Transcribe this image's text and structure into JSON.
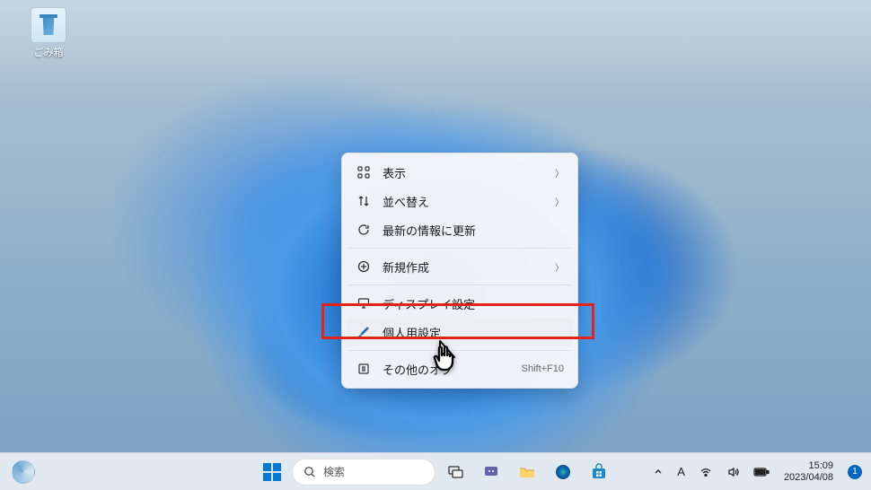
{
  "desktop": {
    "recycle_bin_label": "ごみ箱"
  },
  "context_menu": {
    "view": "表示",
    "sort": "並べ替え",
    "refresh": "最新の情報に更新",
    "new": "新規作成",
    "display_settings": "ディスプレイ設定",
    "personalize": "個人用設定",
    "more_options": "その他のオプ",
    "more_options_shortcut": "Shift+F10"
  },
  "taskbar": {
    "search_placeholder": "検索",
    "ime_a": "A",
    "time": "15:09",
    "date": "2023/04/08",
    "notif_count": "1"
  }
}
